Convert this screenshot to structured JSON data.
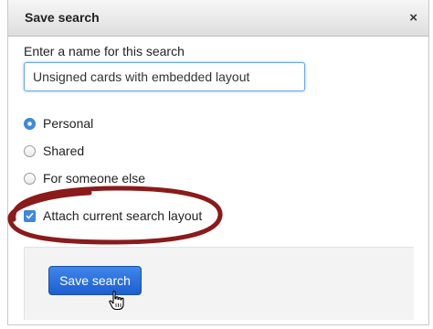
{
  "dialog": {
    "title": "Save search",
    "close_glyph": "×"
  },
  "form": {
    "prompt": "Enter a name for this search",
    "name_value": "Unsigned cards with embedded layout",
    "options": [
      {
        "label": "Personal",
        "selected": true
      },
      {
        "label": "Shared",
        "selected": false
      },
      {
        "label": "For someone else",
        "selected": false
      }
    ],
    "attach_layout_label": "Attach current search layout",
    "attach_layout_checked": true
  },
  "footer": {
    "save_label": "Save search"
  },
  "colors": {
    "accent": "#3d8be0",
    "button": "#1c5ed0",
    "highlight_ellipse": "#8b1a1a"
  },
  "icons": {
    "close": "close-icon",
    "pointer": "hand-pointer-icon"
  }
}
